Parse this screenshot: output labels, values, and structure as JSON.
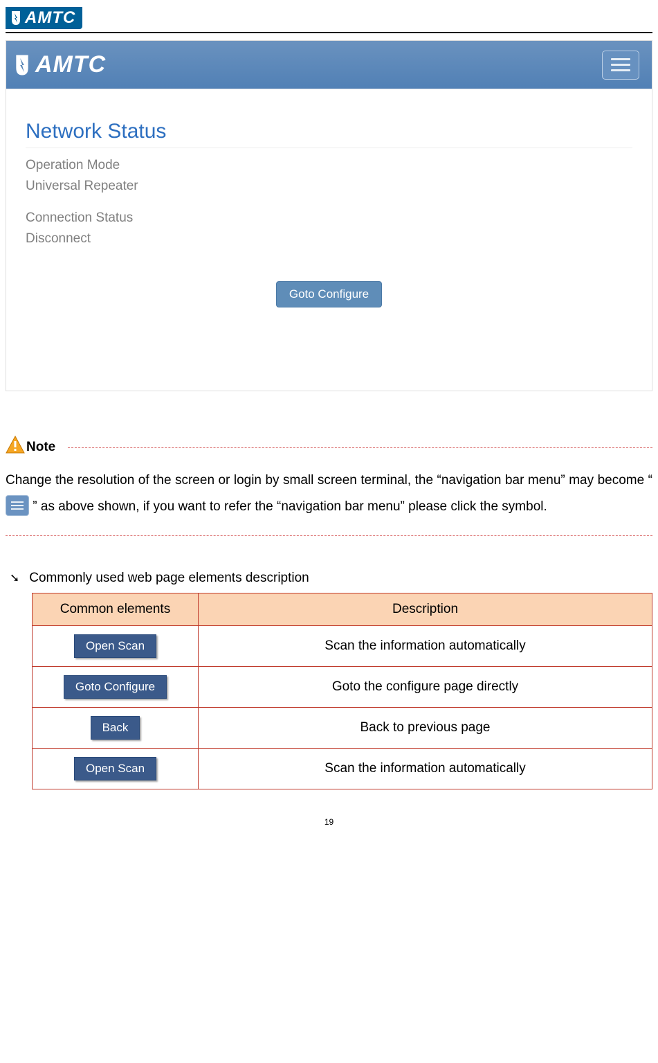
{
  "brand": "AMTC",
  "app": {
    "section_title": "Network Status",
    "op_mode_label": "Operation Mode",
    "op_mode_value": "Universal Repeater",
    "conn_status_label": "Connection Status",
    "conn_status_value": "Disconnect",
    "goto_configure": "Goto Configure"
  },
  "note": {
    "label": "Note",
    "text_1": "Change the resolution of the screen or login by small screen terminal, the “navigation bar menu” may become “",
    "text_2": "” as above shown, if you want to refer the “navigation bar menu” please click the symbol."
  },
  "heading": "Commonly used web page elements description",
  "table": {
    "col1": "Common elements",
    "col2": "Description",
    "rows": [
      {
        "button": "Open Scan",
        "desc": "Scan the information automatically"
      },
      {
        "button": "Goto Configure",
        "desc": "Goto the configure page directly"
      },
      {
        "button": "Back",
        "desc": "Back to previous page"
      },
      {
        "button": "Open Scan",
        "desc": "Scan the information automatically"
      }
    ]
  },
  "page_number": "19"
}
